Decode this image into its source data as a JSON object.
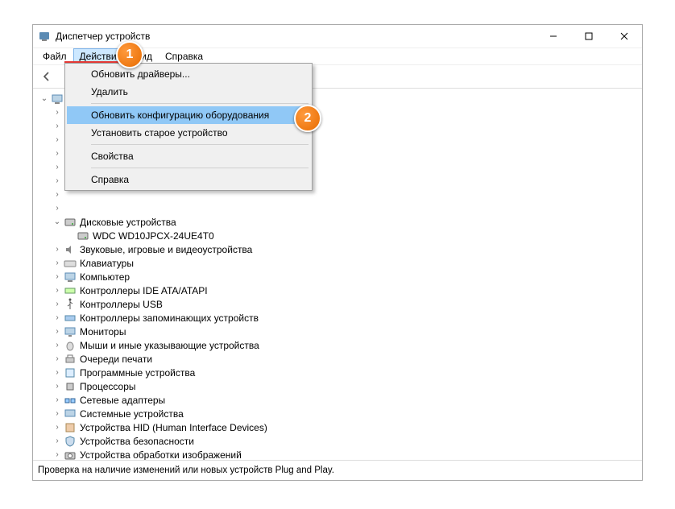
{
  "window": {
    "title": "Диспетчер устройств"
  },
  "menubar": {
    "file": "Файл",
    "action": "Действие",
    "view": "Вид",
    "help": "Справка"
  },
  "dropdown": {
    "update_drivers": "Обновить драйверы...",
    "delete": "Удалить",
    "scan_hardware": "Обновить конфигурацию оборудования",
    "add_legacy": "Установить старое устройство",
    "properties": "Свойства",
    "help": "Справка"
  },
  "tree": {
    "disk_devices": "Дисковые устройства",
    "wdc": "WDC WD10JPCX-24UE4T0",
    "audio": "Звуковые, игровые и видеоустройства",
    "keyboards": "Клавиатуры",
    "computer": "Компьютер",
    "ide": "Контроллеры IDE ATA/ATAPI",
    "usb": "Контроллеры USB",
    "storage": "Контроллеры запоминающих устройств",
    "monitors": "Мониторы",
    "mice": "Мыши и иные указывающие устройства",
    "print_queues": "Очереди печати",
    "software_devices": "Программные устройства",
    "processors": "Процессоры",
    "network": "Сетевые адаптеры",
    "system": "Системные устройства",
    "hid": "Устройства HID (Human Interface Devices)",
    "security": "Устройства безопасности",
    "imaging": "Устройства обработки изображений"
  },
  "statusbar": {
    "text": "Проверка на наличие изменений или новых устройств Plug and Play."
  },
  "callouts": {
    "one": "1",
    "two": "2"
  }
}
